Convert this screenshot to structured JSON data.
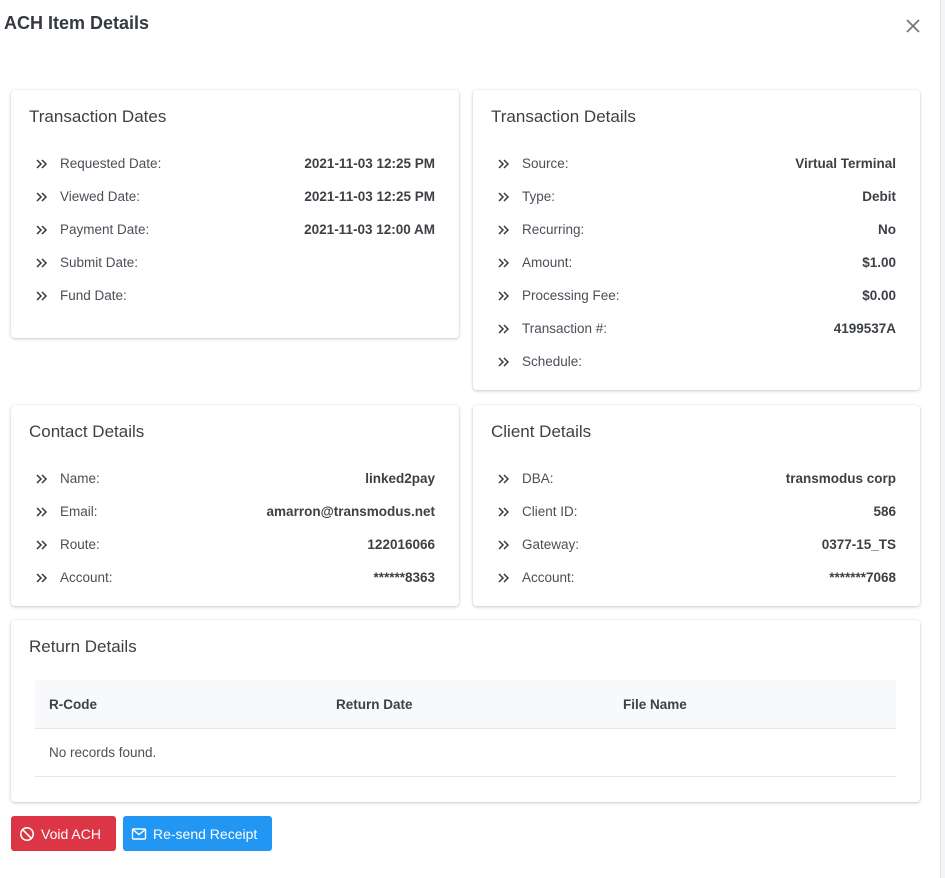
{
  "modal": {
    "title": "ACH Item Details",
    "close_icon": "close-icon"
  },
  "transaction_dates": {
    "title": "Transaction Dates",
    "rows": [
      {
        "label": "Requested Date:",
        "value": "2021-11-03 12:25 PM"
      },
      {
        "label": "Viewed Date:",
        "value": "2021-11-03 12:25 PM"
      },
      {
        "label": "Payment Date:",
        "value": "2021-11-03 12:00 AM"
      },
      {
        "label": "Submit Date:",
        "value": ""
      },
      {
        "label": "Fund Date:",
        "value": ""
      }
    ]
  },
  "transaction_details": {
    "title": "Transaction Details",
    "rows": [
      {
        "label": "Source:",
        "value": "Virtual Terminal"
      },
      {
        "label": "Type:",
        "value": "Debit"
      },
      {
        "label": "Recurring:",
        "value": "No"
      },
      {
        "label": "Amount:",
        "value": "$1.00"
      },
      {
        "label": "Processing Fee:",
        "value": "$0.00"
      },
      {
        "label": "Transaction #:",
        "value": "4199537A"
      },
      {
        "label": "Schedule:",
        "value": ""
      }
    ]
  },
  "contact_details": {
    "title": "Contact Details",
    "rows": [
      {
        "label": "Name:",
        "value": "linked2pay"
      },
      {
        "label": "Email:",
        "value": "amarron@transmodus.net"
      },
      {
        "label": "Route:",
        "value": "122016066"
      },
      {
        "label": "Account:",
        "value": "******8363"
      }
    ]
  },
  "client_details": {
    "title": "Client Details",
    "rows": [
      {
        "label": "DBA:",
        "value": "transmodus corp"
      },
      {
        "label": "Client ID:",
        "value": "586"
      },
      {
        "label": "Gateway:",
        "value": "0377-15_TS"
      },
      {
        "label": "Account:",
        "value": "*******7068"
      }
    ]
  },
  "return_details": {
    "title": "Return Details",
    "columns": [
      "R-Code",
      "Return Date",
      "File Name"
    ],
    "empty_message": "No records found."
  },
  "actions": {
    "void_label": "Void ACH",
    "resend_label": "Re-send Receipt"
  },
  "colors": {
    "danger": "#dc3545",
    "primary": "#2196f3",
    "title_text": "#343a40"
  }
}
